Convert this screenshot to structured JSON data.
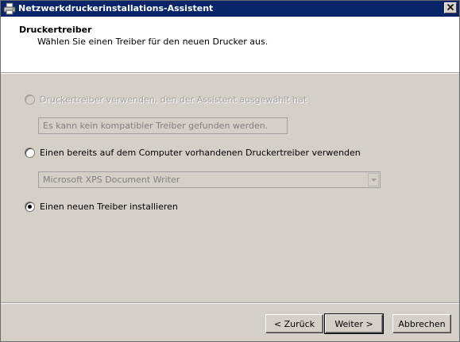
{
  "window": {
    "title": "Netzwerkdruckerinstallations-Assistent",
    "close_symbol": "✕"
  },
  "header": {
    "title": "Druckertreiber",
    "subtitle": "Wählen Sie einen Treiber für den neuen Drucker aus."
  },
  "options": {
    "wizard_driver": {
      "label": "Druckertreiber verwenden, den der Assistent ausgewählt hat",
      "checked": false,
      "enabled": false,
      "field_value": "Es kann kein kompatibler Treiber gefunden werden."
    },
    "existing_driver": {
      "label": "Einen bereits auf dem Computer vorhandenen Druckertreiber verwenden",
      "checked": false,
      "enabled": true,
      "selected_driver": "Microsoft XPS Document Writer"
    },
    "new_driver": {
      "label": "Einen neuen Treiber installieren",
      "checked": true,
      "enabled": true
    }
  },
  "buttons": {
    "back": "< Zurück",
    "next": "Weiter >",
    "cancel": "Abbrechen"
  },
  "icons": {
    "title": "printer-icon",
    "close": "close-icon",
    "combo": "chevron-down-icon"
  },
  "colors": {
    "titlebar": "#0a246a",
    "dialog_bg": "#d4d0c8",
    "header_bg": "#ffffff",
    "disabled_text": "#a0a0a0"
  }
}
